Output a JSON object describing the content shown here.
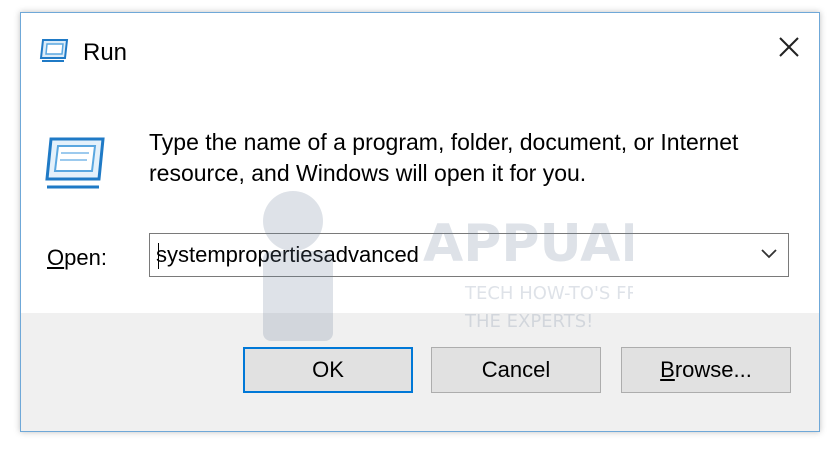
{
  "window": {
    "title": "Run",
    "title_icon": "run-icon",
    "close_icon": "close-icon"
  },
  "content": {
    "icon": "run-icon",
    "description": "Type the name of a program, folder, document, or Internet resource, and Windows will open it for you.",
    "open_label_accel": "O",
    "open_label_rest": "pen:",
    "open_value": "systempropertiesadvanced",
    "dropdown_icon": "chevron-down-icon"
  },
  "buttons": {
    "ok": "OK",
    "cancel": "Cancel",
    "browse_accel": "B",
    "browse_rest": "rowse..."
  },
  "watermark": {
    "brand": "APPUALS",
    "tagline_1": "TECH HOW-TO'S FROM",
    "tagline_2": "THE EXPERTS!"
  },
  "colors": {
    "accent": "#0078d7",
    "footer_bg": "#f0f0f0",
    "button_bg": "#e1e1e1",
    "window_border": "#6fa8d8"
  }
}
